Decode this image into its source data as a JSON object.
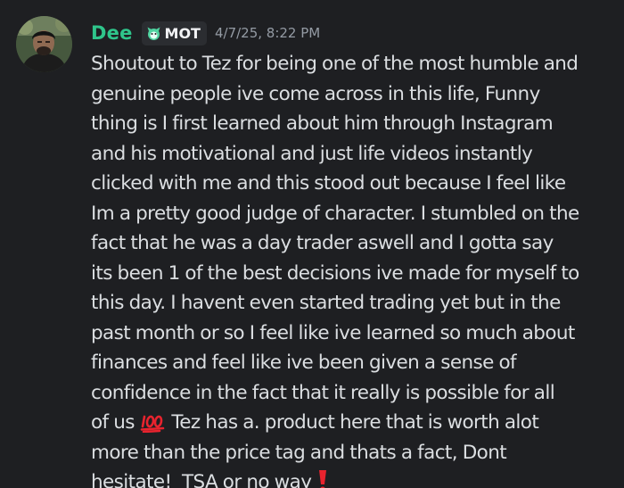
{
  "message": {
    "author": "Dee",
    "tag": {
      "label": "MOT",
      "icon": "mascot-head-icon",
      "color": "#4fd3a0"
    },
    "timestamp": "4/7/25, 8:22 PM",
    "username_color": "#2fc58b",
    "avatar_icon": "user-avatar-photo",
    "lines": [
      "Shoutout to Tez for being one of the most humble and",
      "genuine people ive come across in this life, Funny",
      "thing is I first learned about him through Instagram",
      "and his motivational and just life videos instantly",
      "clicked with me and this stood out because I feel like",
      "Im a pretty good judge of character. I stumbled on the",
      "fact that he was a day trader aswell and I gotta say",
      "its been 1 of the best decisions ive made for myself to",
      "this day. I havent even started trading yet but in the",
      "past month or so I feel like ive learned so much about",
      "finances and feel like ive been given a sense of",
      "confidence in the fact that it really is possible for all"
    ],
    "line13_before": "of us ",
    "emoji_hundred": "hundred-points-emoji",
    "line13_after": " Tez has a. product here that is worth alot",
    "line14": "more than the price tag and thats a fact, Dont",
    "line15": "hesitate!  TSA or no way ",
    "emoji_exclamation": "red-exclamation-emoji"
  }
}
